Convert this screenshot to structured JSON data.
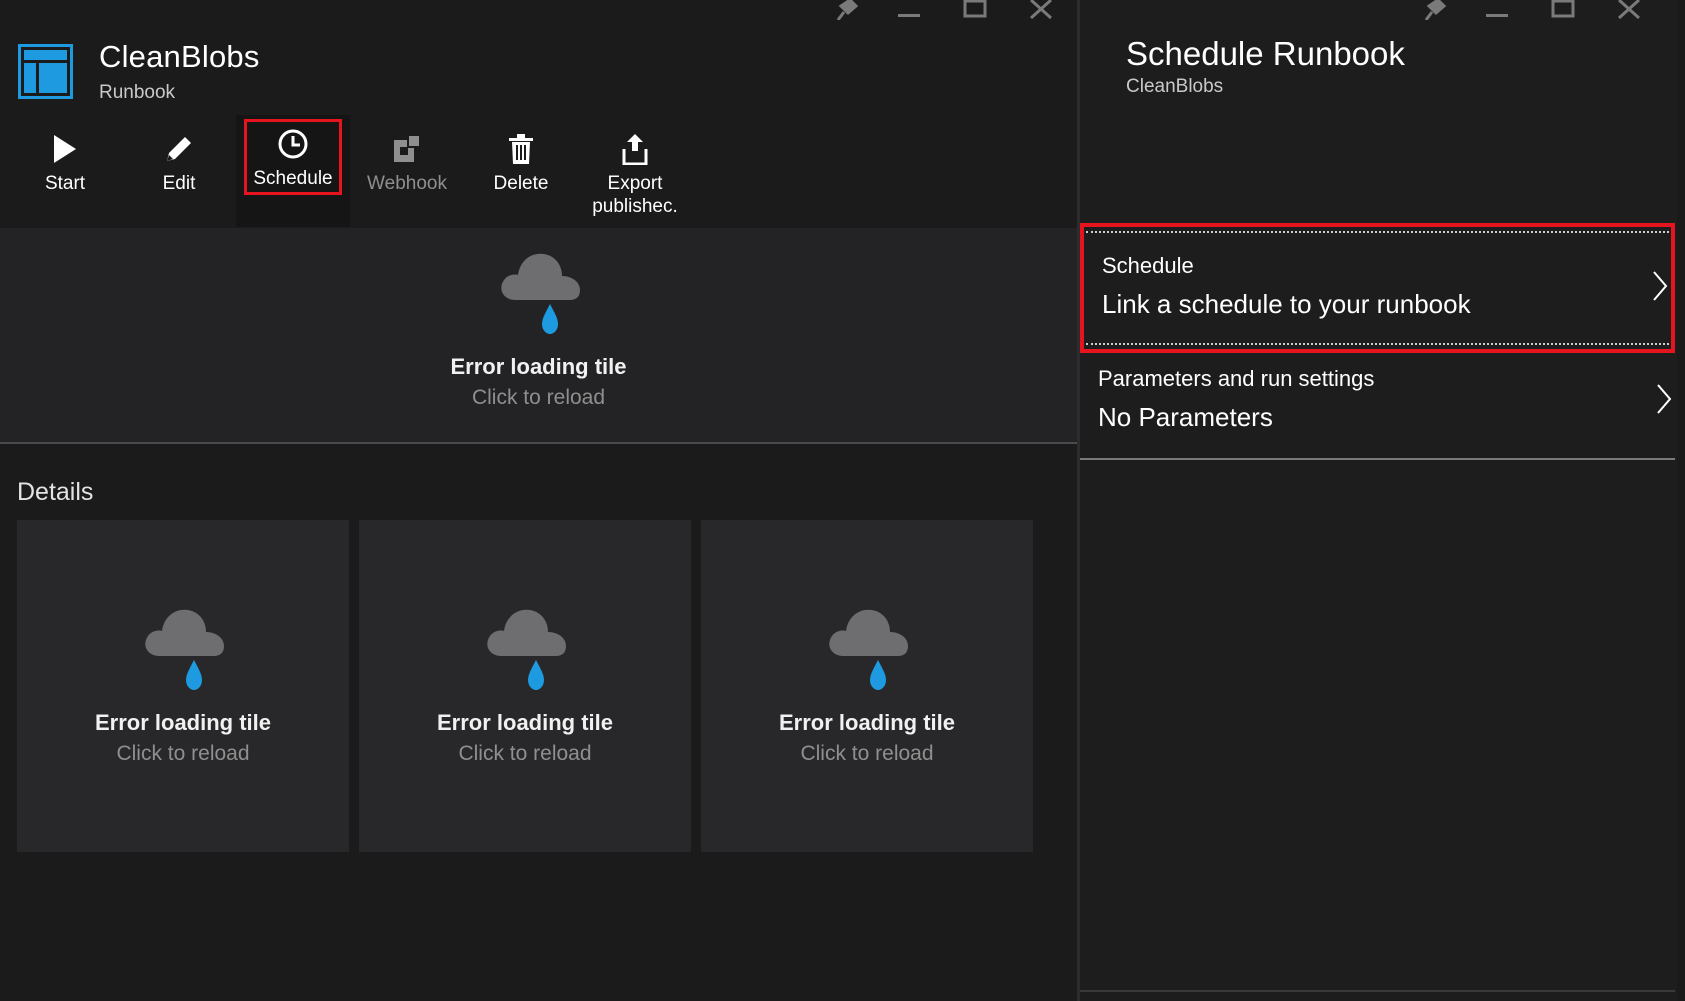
{
  "left_blade": {
    "title": "CleanBlobs",
    "subtitle": "Runbook",
    "window_controls": [
      "pin-icon",
      "minimize-icon",
      "maximize-icon",
      "close-icon"
    ],
    "toolbar": [
      {
        "label": "Start",
        "icon": "play-icon",
        "enabled": true
      },
      {
        "label": "Edit",
        "icon": "pencil-icon",
        "enabled": true
      },
      {
        "label": "Schedule",
        "icon": "clock-icon",
        "enabled": true,
        "highlighted": true
      },
      {
        "label": "Webhook",
        "icon": "webhook-icon",
        "enabled": false
      },
      {
        "label": "Delete",
        "icon": "trash-icon",
        "enabled": true
      },
      {
        "label": "Export published",
        "label_line1": "Export",
        "label_line2": "publishec.",
        "icon": "export-icon",
        "enabled": true
      }
    ],
    "hero_tile": {
      "title": "Error loading tile",
      "subtitle": "Click to reload"
    },
    "details": {
      "title": "Details",
      "tiles": [
        {
          "title": "Error loading tile",
          "subtitle": "Click to reload"
        },
        {
          "title": "Error loading tile",
          "subtitle": "Click to reload"
        },
        {
          "title": "Error loading tile",
          "subtitle": "Click to reload"
        }
      ]
    }
  },
  "right_blade": {
    "title": "Schedule Runbook",
    "subtitle": "CleanBlobs",
    "rows": [
      {
        "label": "Schedule",
        "value": "Link a schedule to your runbook",
        "highlighted": true
      },
      {
        "label": "Parameters and run settings",
        "value": "No Parameters"
      }
    ]
  },
  "colors": {
    "background": "#1b1b1c",
    "tile": "#28282a",
    "highlight_border": "#e5141e",
    "accent_blue": "#1e9be0",
    "cloud_gray": "#6e6e70"
  }
}
